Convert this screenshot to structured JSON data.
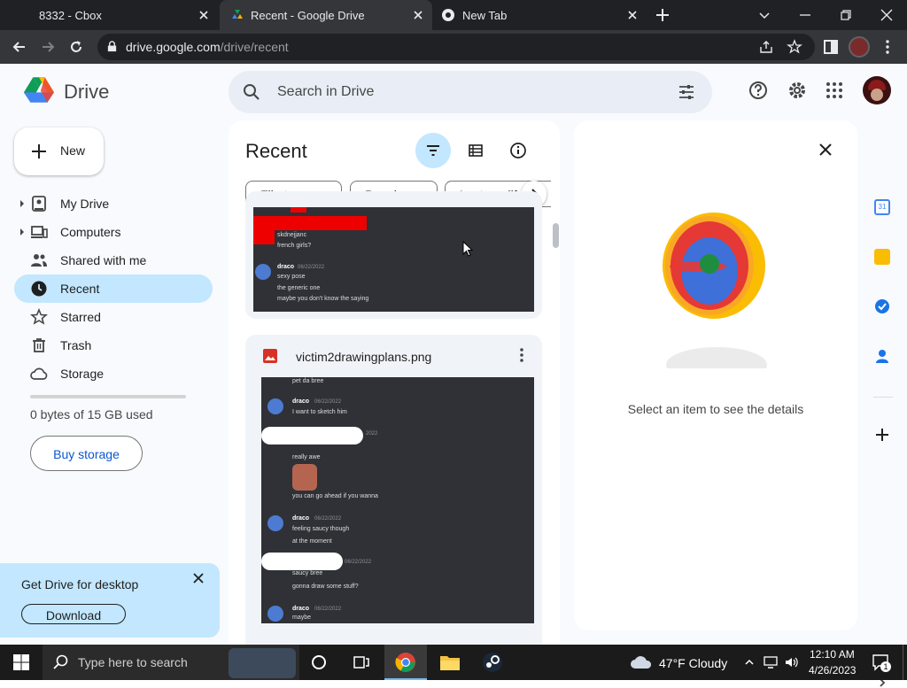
{
  "browser": {
    "tabs": [
      {
        "title": "8332 - Cbox"
      },
      {
        "title": "Recent - Google Drive"
      },
      {
        "title": "New Tab"
      }
    ],
    "url_domain": "drive.google.com",
    "url_path": "/drive/recent"
  },
  "drive": {
    "product_name": "Drive",
    "search_placeholder": "Search in Drive",
    "new_label": "New",
    "nav": [
      {
        "label": "My Drive",
        "icon": "my-drive-icon"
      },
      {
        "label": "Computers",
        "icon": "computers-icon"
      },
      {
        "label": "Shared with me",
        "icon": "shared-icon"
      },
      {
        "label": "Recent",
        "icon": "clock-icon"
      },
      {
        "label": "Starred",
        "icon": "star-icon"
      },
      {
        "label": "Trash",
        "icon": "trash-icon"
      },
      {
        "label": "Storage",
        "icon": "cloud-icon"
      }
    ],
    "storage_used_fraction": 0,
    "storage_text": "0 bytes of 15 GB used",
    "buy_storage_label": "Buy storage",
    "promo_title": "Get Drive for desktop",
    "promo_button": "Download",
    "colors": {
      "accent": "#0b57d0",
      "selected": "#c2e7ff"
    }
  },
  "main": {
    "title": "Recent",
    "chips": [
      "File type",
      "People",
      "Last modif"
    ],
    "files": [
      {
        "name": "victim2drawingplans.png",
        "preview": [
          {
            "text": "pet da bree"
          },
          {
            "name": "draco",
            "date": "06/22/2022",
            "lines": [
              "I want to sketch him"
            ]
          },
          {
            "date": "2022",
            "lines": [
              "really awe"
            ]
          },
          {
            "lines": [
              "you can go ahead if you wanna"
            ]
          },
          {
            "name": "draco",
            "date": "06/22/2022",
            "lines": [
              "feeling saucy though",
              "at the moment"
            ]
          },
          {
            "date": "06/22/2022",
            "lines": [
              "saucy bree",
              "gonna draw some stuff?"
            ]
          },
          {
            "name": "draco",
            "date": "06/22/2022",
            "lines": [
              "maybe"
            ]
          }
        ]
      }
    ],
    "prev_preview": {
      "lines": [
        "skdnejjanc",
        "french girls?"
      ],
      "message": {
        "name": "draco",
        "date": "06/22/2022",
        "lines": [
          "sexy pose",
          "the generic one",
          "maybe you don't know the saying"
        ]
      }
    }
  },
  "details": {
    "empty_text": "Select an item to see the details"
  },
  "taskbar": {
    "search_placeholder": "Type here to search",
    "weather": "47°F  Cloudy",
    "time": "12:10 AM",
    "date": "4/26/2023",
    "notification_count": "1"
  }
}
